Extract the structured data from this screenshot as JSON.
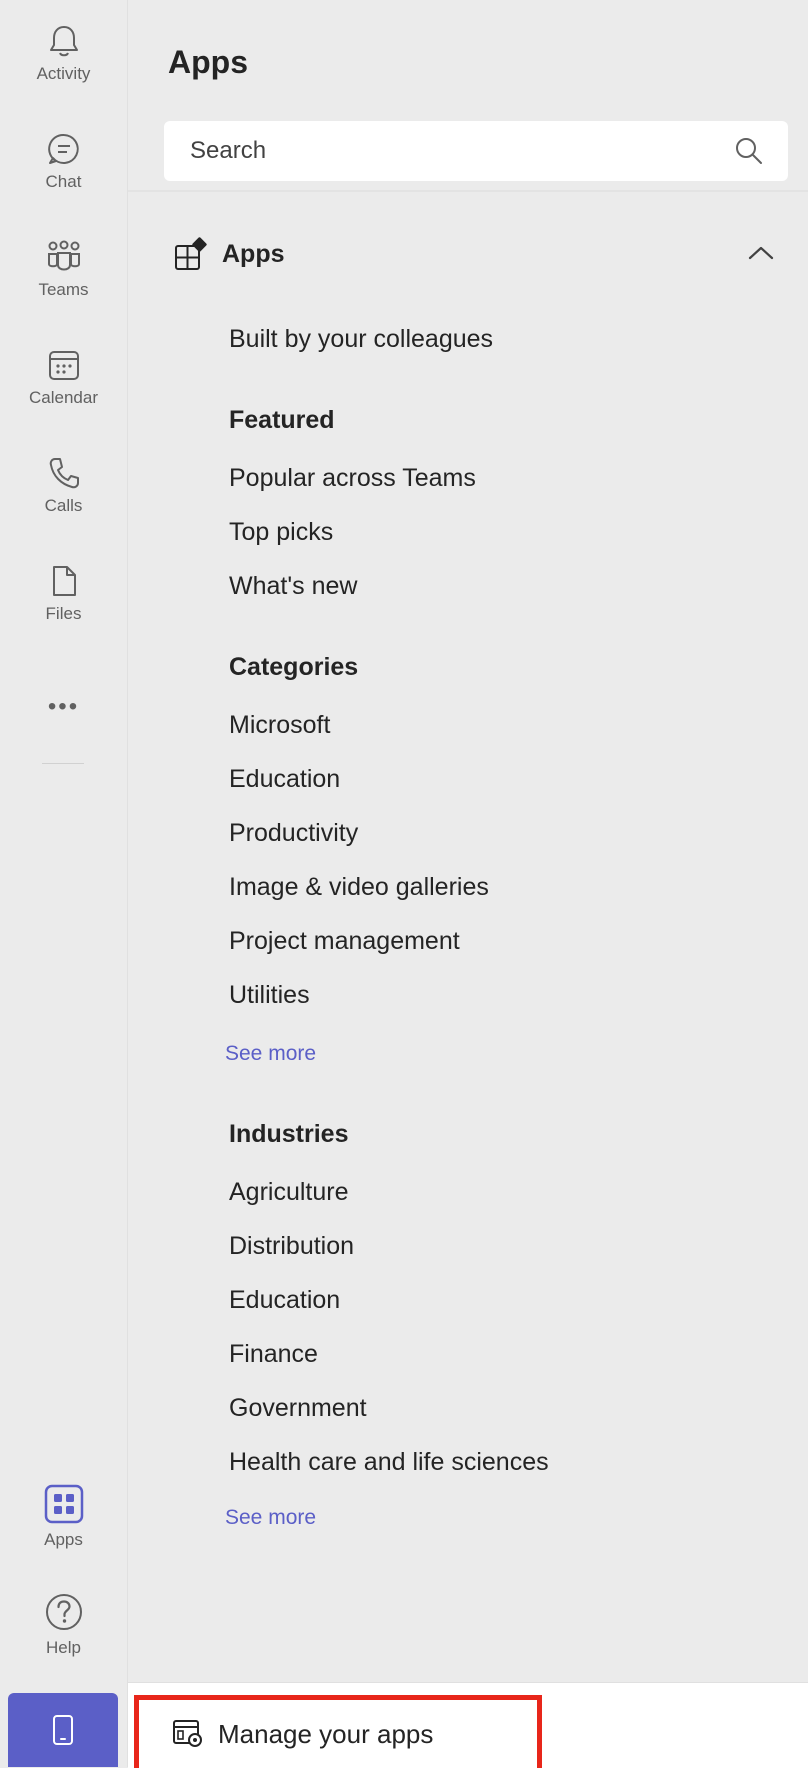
{
  "rail": {
    "items": [
      {
        "label": "Activity",
        "icon": "bell-icon"
      },
      {
        "label": "Chat",
        "icon": "chat-icon"
      },
      {
        "label": "Teams",
        "icon": "teams-icon"
      },
      {
        "label": "Calendar",
        "icon": "calendar-icon"
      },
      {
        "label": "Calls",
        "icon": "phone-icon"
      },
      {
        "label": "Files",
        "icon": "file-icon"
      }
    ],
    "more": "•••",
    "apps_label": "Apps",
    "help_label": "Help",
    "active_color": "#5b5fc7"
  },
  "panel": {
    "title": "Apps",
    "search_placeholder": "Search",
    "section_title": "Apps",
    "built_by": "Built by your colleagues",
    "featured": {
      "heading": "Featured",
      "items": [
        "Popular across Teams",
        "Top picks",
        "What's new"
      ]
    },
    "categories": {
      "heading": "Categories",
      "items": [
        "Microsoft",
        "Education",
        "Productivity",
        "Image & video galleries",
        "Project management",
        "Utilities"
      ],
      "see_more": "See more"
    },
    "industries": {
      "heading": "Industries",
      "items": [
        "Agriculture",
        "Distribution",
        "Education",
        "Finance",
        "Government",
        "Health care and life sciences"
      ],
      "see_more": "See more"
    }
  },
  "footer": {
    "manage_label": "Manage your apps",
    "highlight_color": "#e8261a"
  }
}
